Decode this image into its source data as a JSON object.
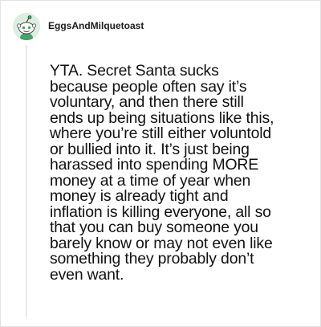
{
  "comment": {
    "author": "EggsAndMilquetoast",
    "avatar_icon": "reddit-snoo-avatar-icon",
    "body": "YTA. Secret Santa sucks\nbecause people often say it’s\nvoluntary, and then there still\nends up being situations like this,\nwhere you’re still either voluntold\nor bullied into it. It’s just being\nharassed into spending MORE\nmoney at a time of year when\nmoney is already tight and\ninflation is killing everyone, all so\nthat you can buy someone you\nbarely know or may not even like\nsomething they probably don’t\neven want."
  },
  "colors": {
    "avatar_bg": "#dbeee0",
    "avatar_accent": "#46a364",
    "thread_line": "#e8e8e8",
    "text": "#111111"
  }
}
